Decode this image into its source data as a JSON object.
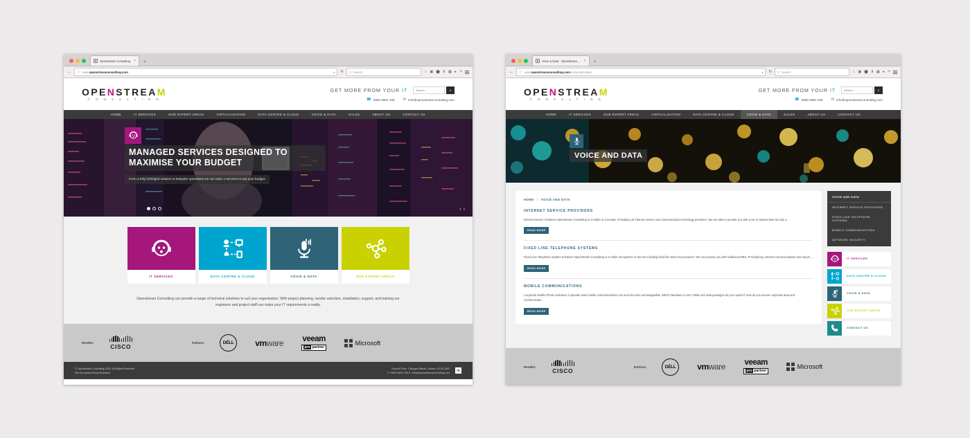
{
  "colors": {
    "pink": "#a5177c",
    "blue": "#00a5cf",
    "teal": "#2e6378",
    "lime": "#c9d200",
    "nav_dark": "#3b3b3b",
    "partners_bg": "#c9c9c9"
  },
  "window_left": {
    "browser": {
      "tab_title": "Openstream Consulting",
      "tab_close": "×",
      "new_tab": "+",
      "url_prefix": "www.",
      "url_bold": "openstreamconsulting.com",
      "url_suffix": "",
      "search_placeholder": "Search",
      "back_icon": "←",
      "reload_icon": "↻"
    },
    "header": {
      "logo_main_pre": "OPE",
      "logo_main_n": "N",
      "logo_main_mid": "STREA",
      "logo_main_m": "M",
      "logo_sub": "C O N S U L T I N G",
      "tagline_a": "GET MORE FROM YOUR ",
      "tagline_b": "IT",
      "search_placeholder": "Search...",
      "search_icon": "⌕",
      "phone": "0800 6891 436",
      "phone_icon": "☎",
      "email": "info@openstreamconsulting.com",
      "email_icon": "✉"
    },
    "nav": [
      {
        "label": "HOME",
        "active": false
      },
      {
        "label": "IT SERVICES",
        "active": false
      },
      {
        "label": "OUR EXPERT AREAS",
        "active": false
      },
      {
        "label": "VIRTUALISATION",
        "active": false
      },
      {
        "label": "DATA CENTRE & CLOUD",
        "active": false
      },
      {
        "label": "VOICE & DATA",
        "active": false
      },
      {
        "label": "SALES",
        "active": false
      },
      {
        "label": "ABOUT US",
        "active": false
      },
      {
        "label": "CONTACT US",
        "active": false
      }
    ],
    "hero": {
      "badge_icon": "headset-icon",
      "title": "MANAGED SERVICES DESIGNED TO MAXIMISE YOUR BUDGET",
      "subtitle": "From a fully managed solution to bespoke operations we can tailor a services to suit your budget.",
      "slide_count": 3,
      "active_slide": 1,
      "prev_icon": "‹",
      "next_icon": "›"
    },
    "tiles": [
      {
        "label": "IT SERVICES",
        "color_class": "t-pink",
        "icon": "headset-icon"
      },
      {
        "label": "DATA CENTRE & CLOUD",
        "color_class": "t-blue",
        "icon": "network-icon"
      },
      {
        "label": "VOICE & DATA",
        "color_class": "t-teal",
        "icon": "microphone-icon"
      },
      {
        "label": "OUR EXPERT AREAS",
        "color_class": "t-lime",
        "icon": "nodes-icon"
      }
    ],
    "intro": "Openstream Consulting can provide a range of technical solutions to suit your organisation. With project planning, vendor selection, installation, support, and training our engineers and project staff can make your IT requirements a reality."
  },
  "window_right": {
    "browser": {
      "tab_title": "Voice & Data - Openstream ...",
      "tab_close": "×",
      "new_tab": "+",
      "url_prefix": "www.",
      "url_bold": "openstreamconsulting.com",
      "url_suffix": "/voice-and-data/",
      "search_placeholder": "Search",
      "back_icon": "←",
      "reload_icon": "↻"
    },
    "hero": {
      "badge_icon": "microphone-icon",
      "title": "VOICE AND DATA"
    },
    "breadcrumb": {
      "home": "HOME",
      "separator": ">",
      "current": "VOICE AND DATA"
    },
    "sections": [
      {
        "heading": "INTERNET SERVICE PROVIDERS",
        "body": "Internet Service Solutions   Openstream Consulting is re-seller to a number of leading UK internet service and communication technology providers.   We are able to provide you with a set of options that not only s...",
        "cta": "READ MORE"
      },
      {
        "heading": "FIXED LINE TELEPHONE SYSTEMS",
        "body": "Fixed Line Telephone System Solutions   Openstream Consulting is re-seller and partner to the UK's leading fixed line telecoms providers.  We can provide you with traditional PBX, IP telephony, Internet communications and sat ph...",
        "cta": "READ MORE"
      },
      {
        "heading": "MOBILE COMMUNICATIONS",
        "body": "Corporate Mobile Phone Solutions   Corporate level mobile communications can soon become unmanageable.  Which handsets to use?  What size data packages do you require?  How do you secure corporate data and communicatio...",
        "cta": "READ MORE"
      }
    ],
    "side_list": [
      {
        "label": "VOICE AND DATA",
        "head": true
      },
      {
        "label": "INTERNET SERVICE PROVIDERS",
        "head": false
      },
      {
        "label": "FIXED LINE TELEPHONE SYSTEMS",
        "head": false
      },
      {
        "label": "MOBILE COMMUNICATIONS",
        "head": false
      },
      {
        "label": "NETWORK SECURITY",
        "head": false
      }
    ],
    "side_buttons": [
      {
        "label": "IT SERVICES",
        "color_class": "s-pink",
        "icon": "headset-icon"
      },
      {
        "label": "DATA CENTRE & CLOUD",
        "color_class": "s-blue",
        "icon": "network-icon"
      },
      {
        "label": "VOICE & DATA",
        "color_class": "s-teal",
        "icon": "microphone-icon"
      },
      {
        "label": "OUR EXPERT AREAS",
        "color_class": "s-lime",
        "icon": "nodes-icon"
      },
      {
        "label": "CONTACT US",
        "color_class": "s-tealc",
        "icon": "phone-icon"
      }
    ]
  },
  "partners": {
    "reseller_label": "Reseller:",
    "partners_label": "Partners:",
    "cisco_word": "CISCO",
    "dell_word": "DÉLL",
    "vmware_bold": "vm",
    "vmware_light": "ware",
    "veeam_top": "veeam",
    "veeam_pro": "pro",
    "veeam_partner": "partner",
    "microsoft_word": "Microsoft"
  },
  "footer": {
    "copyright": "© Openstream Consulting 2015. All Rights Reserved",
    "credit": "Site by Implica Brand Evolution",
    "address": "Ground Floor, 2 Burgon Street, London, EC4V 5DR",
    "contact": "T / 0800 6891 436    E / info@openstreamconsulting.com",
    "social_icon": "in"
  }
}
